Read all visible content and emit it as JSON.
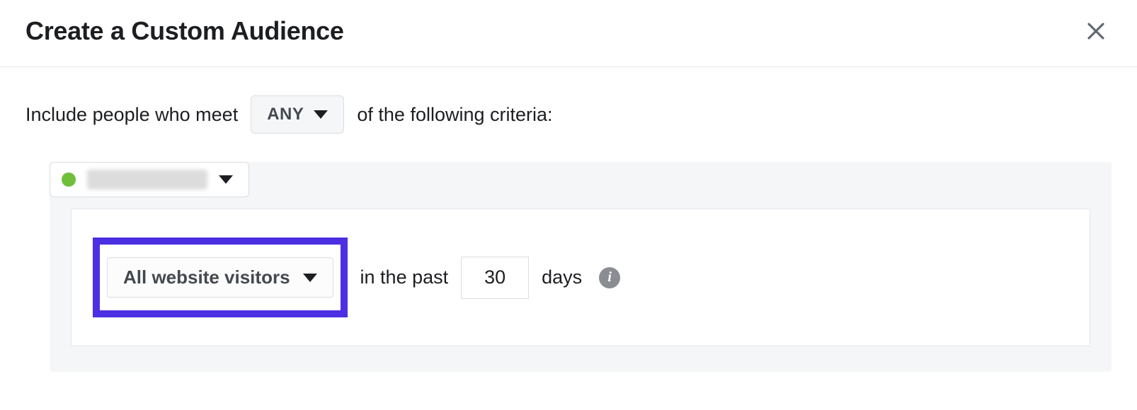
{
  "header": {
    "title": "Create a Custom Audience"
  },
  "criteria": {
    "sentence_prefix": "Include people who meet",
    "match_mode": "ANY",
    "sentence_suffix": "of the following criteria:"
  },
  "source": {
    "status_color": "#6fbf3b",
    "label_redacted": true
  },
  "rule": {
    "visitor_type": "All website visitors",
    "mid_text": "in the past",
    "days_value": "30",
    "days_label": "days"
  }
}
